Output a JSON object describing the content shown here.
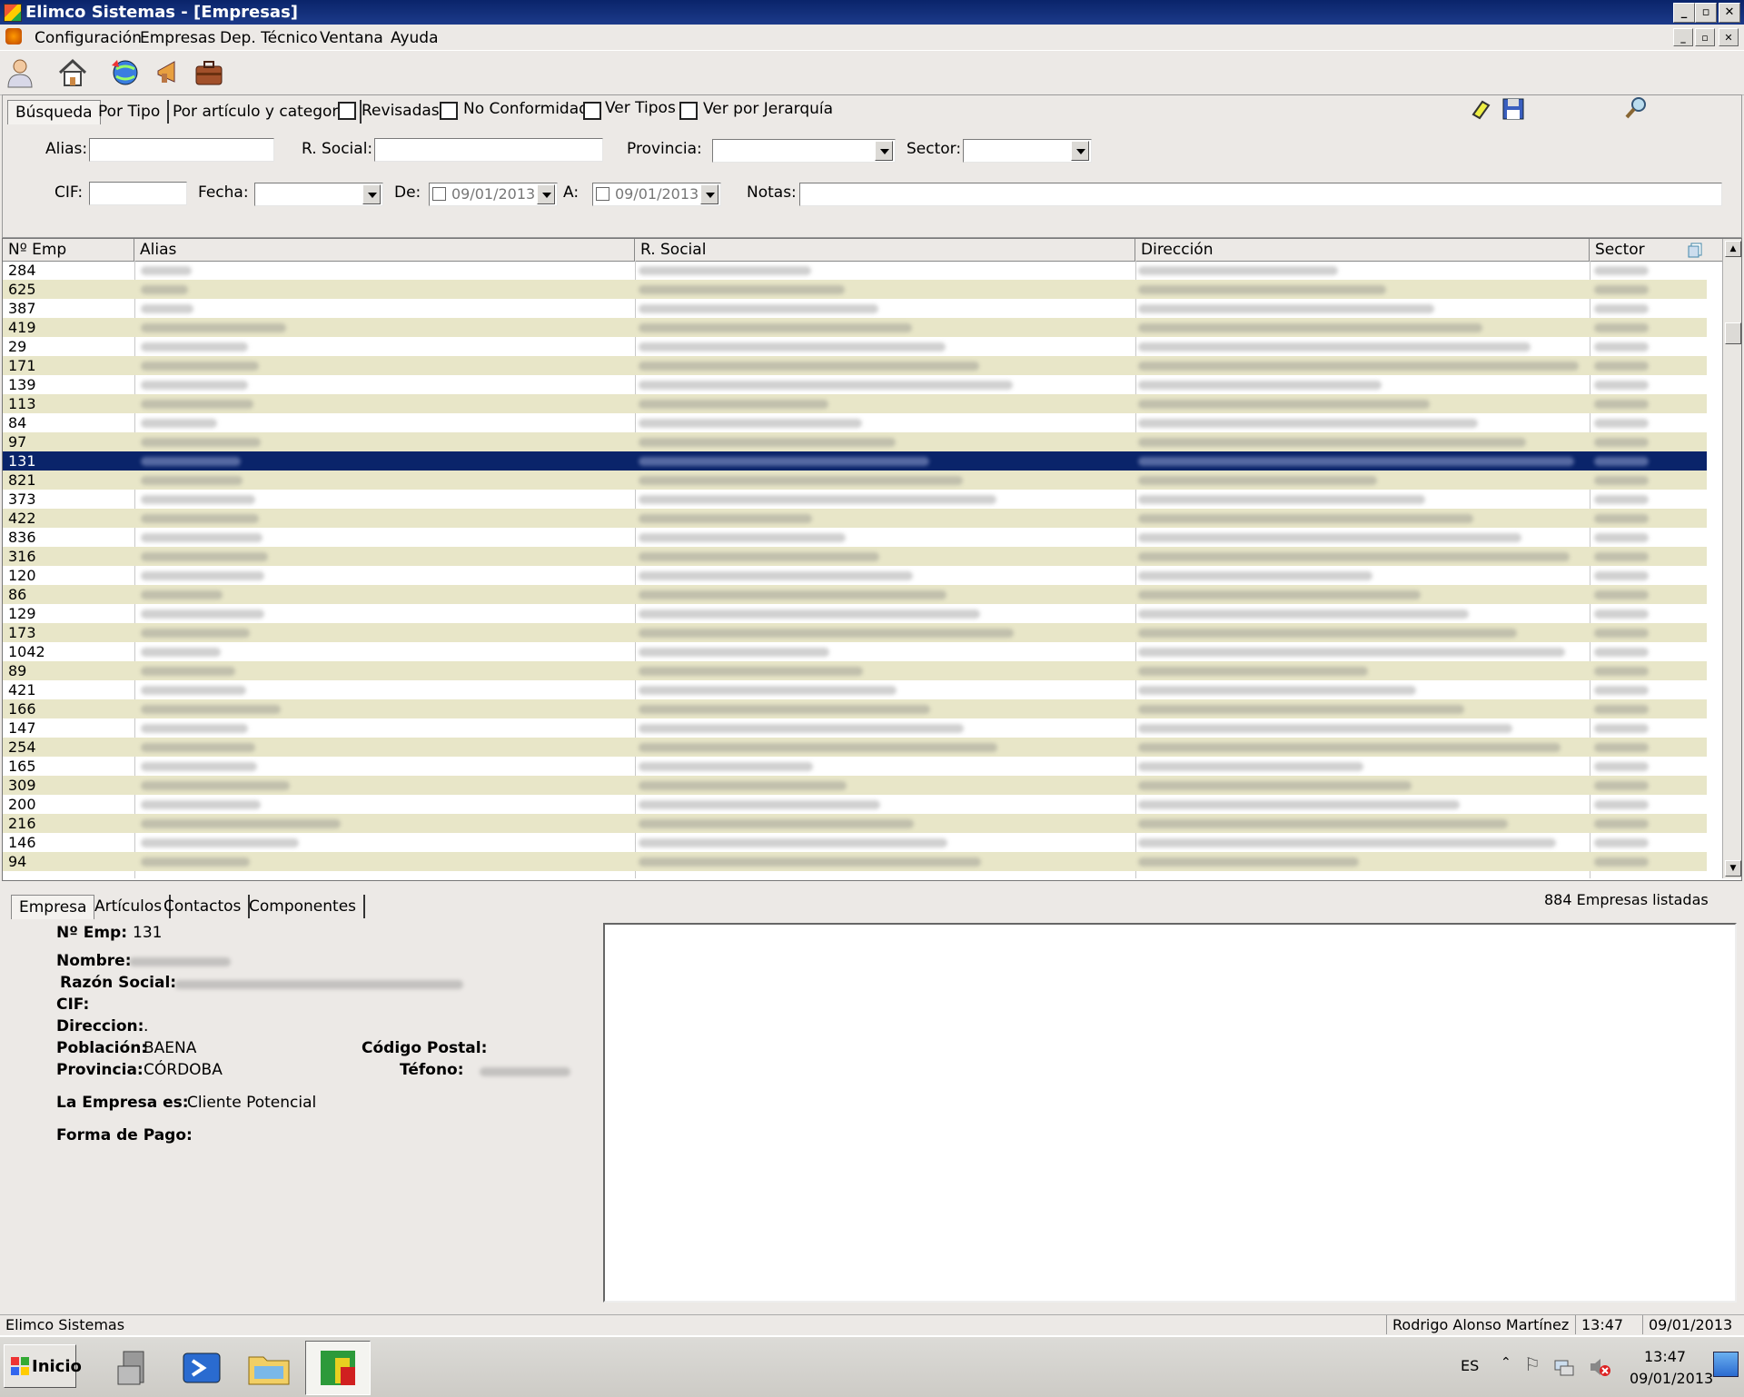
{
  "window": {
    "title": "Elimco Sistemas - [Empresas]"
  },
  "menu": [
    "Configuración",
    "Empresas",
    "Dep. Técnico",
    "Ventana",
    "Ayuda"
  ],
  "toolbar_icons": [
    "user-icon",
    "home-icon",
    "globe-refresh-icon",
    "megaphone-icon",
    "briefcase-icon"
  ],
  "search_tabs": [
    "Búsqueda",
    "Por Tipo",
    "Por artículo y categoría"
  ],
  "filters": {
    "checkboxes": [
      "Revisadas",
      "No Conformidad",
      "Ver Tipos",
      "Ver por Jerarquía"
    ],
    "alias_label": "Alias:",
    "rsocial_label": "R. Social:",
    "provincia_label": "Provincia:",
    "sector_label": "Sector:",
    "cif_label": "CIF:",
    "fecha_label": "Fecha:",
    "de_label": "De:",
    "a_label": "A:",
    "notas_label": "Notas:",
    "de_value": "09/01/2013",
    "a_value": "09/01/2013"
  },
  "grid": {
    "columns": [
      "Nº Emp",
      "Alias",
      "R. Social",
      "Dirección",
      "Sector"
    ],
    "rows": [
      "284",
      "625",
      "387",
      "419",
      "29",
      "171",
      "139",
      "113",
      "84",
      "97",
      "131",
      "821",
      "373",
      "422",
      "836",
      "316",
      "120",
      "86",
      "129",
      "173",
      "1042",
      "89",
      "421",
      "166",
      "147",
      "254",
      "165",
      "309",
      "200",
      "216",
      "146",
      "94"
    ],
    "selected_row": "131"
  },
  "detail_tabs": [
    "Empresa",
    "Artículos",
    "Contactos",
    "Componentes"
  ],
  "count_text": "884 Empresas listadas",
  "detail": {
    "num_label": "Nº Emp:",
    "num_value": "131",
    "nombre_label": "Nombre:",
    "razon_label": "Razón Social:",
    "cif_label": "CIF:",
    "direccion_label": "Direccion:",
    "direccion_value": ".",
    "poblacion_label": "Población:",
    "poblacion_value": "BAENA",
    "cp_label": "Código Postal:",
    "provincia_label": "Provincia:",
    "provincia_value": "CÓRDOBA",
    "telefono_label": "Téfono:",
    "tipo_label": "La Empresa es:",
    "tipo_value": "Cliente Potencial",
    "pago_label": "Forma de Pago:"
  },
  "status": {
    "app": "Elimco Sistemas",
    "user": "Rodrigo Alonso Martínez P",
    "time": "13:47",
    "date": "09/01/2013"
  },
  "taskbar": {
    "start": "Inicio",
    "lang": "ES",
    "clock_time": "13:47",
    "clock_date": "09/01/2013"
  }
}
